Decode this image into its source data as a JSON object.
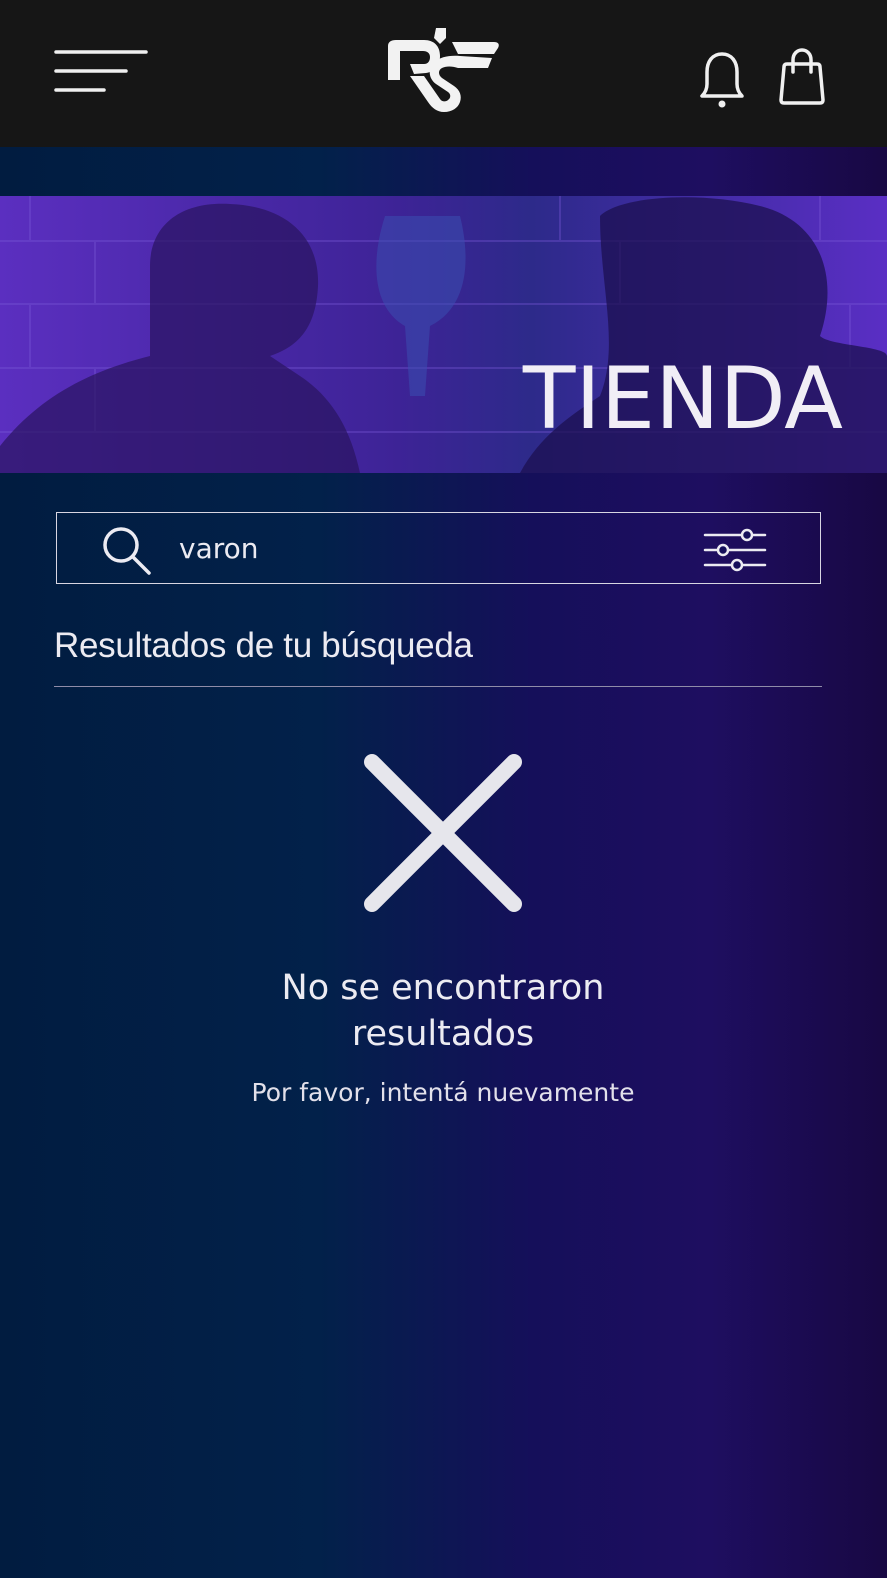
{
  "header": {
    "menu_icon": "hamburger-menu-icon",
    "logo_icon": "rs-logo",
    "notifications_icon": "bell-icon",
    "cart_icon": "shopping-bag-icon"
  },
  "hero": {
    "title": "TIENDA"
  },
  "search": {
    "value": "varon",
    "icon": "search-icon",
    "filter_icon": "sliders-icon"
  },
  "results": {
    "heading": "Resultados de tu búsqueda"
  },
  "empty_state": {
    "icon": "close-icon",
    "title_line1": "No se encontraron",
    "title_line2": "resultados",
    "subtitle": "Por favor, intentá nuevamente"
  },
  "colors": {
    "topbar": "#161616",
    "text": "#ecebf2",
    "gradient_left": "#011c40",
    "gradient_right": "#1e0e60",
    "hero_tint": "#4a1fae"
  }
}
